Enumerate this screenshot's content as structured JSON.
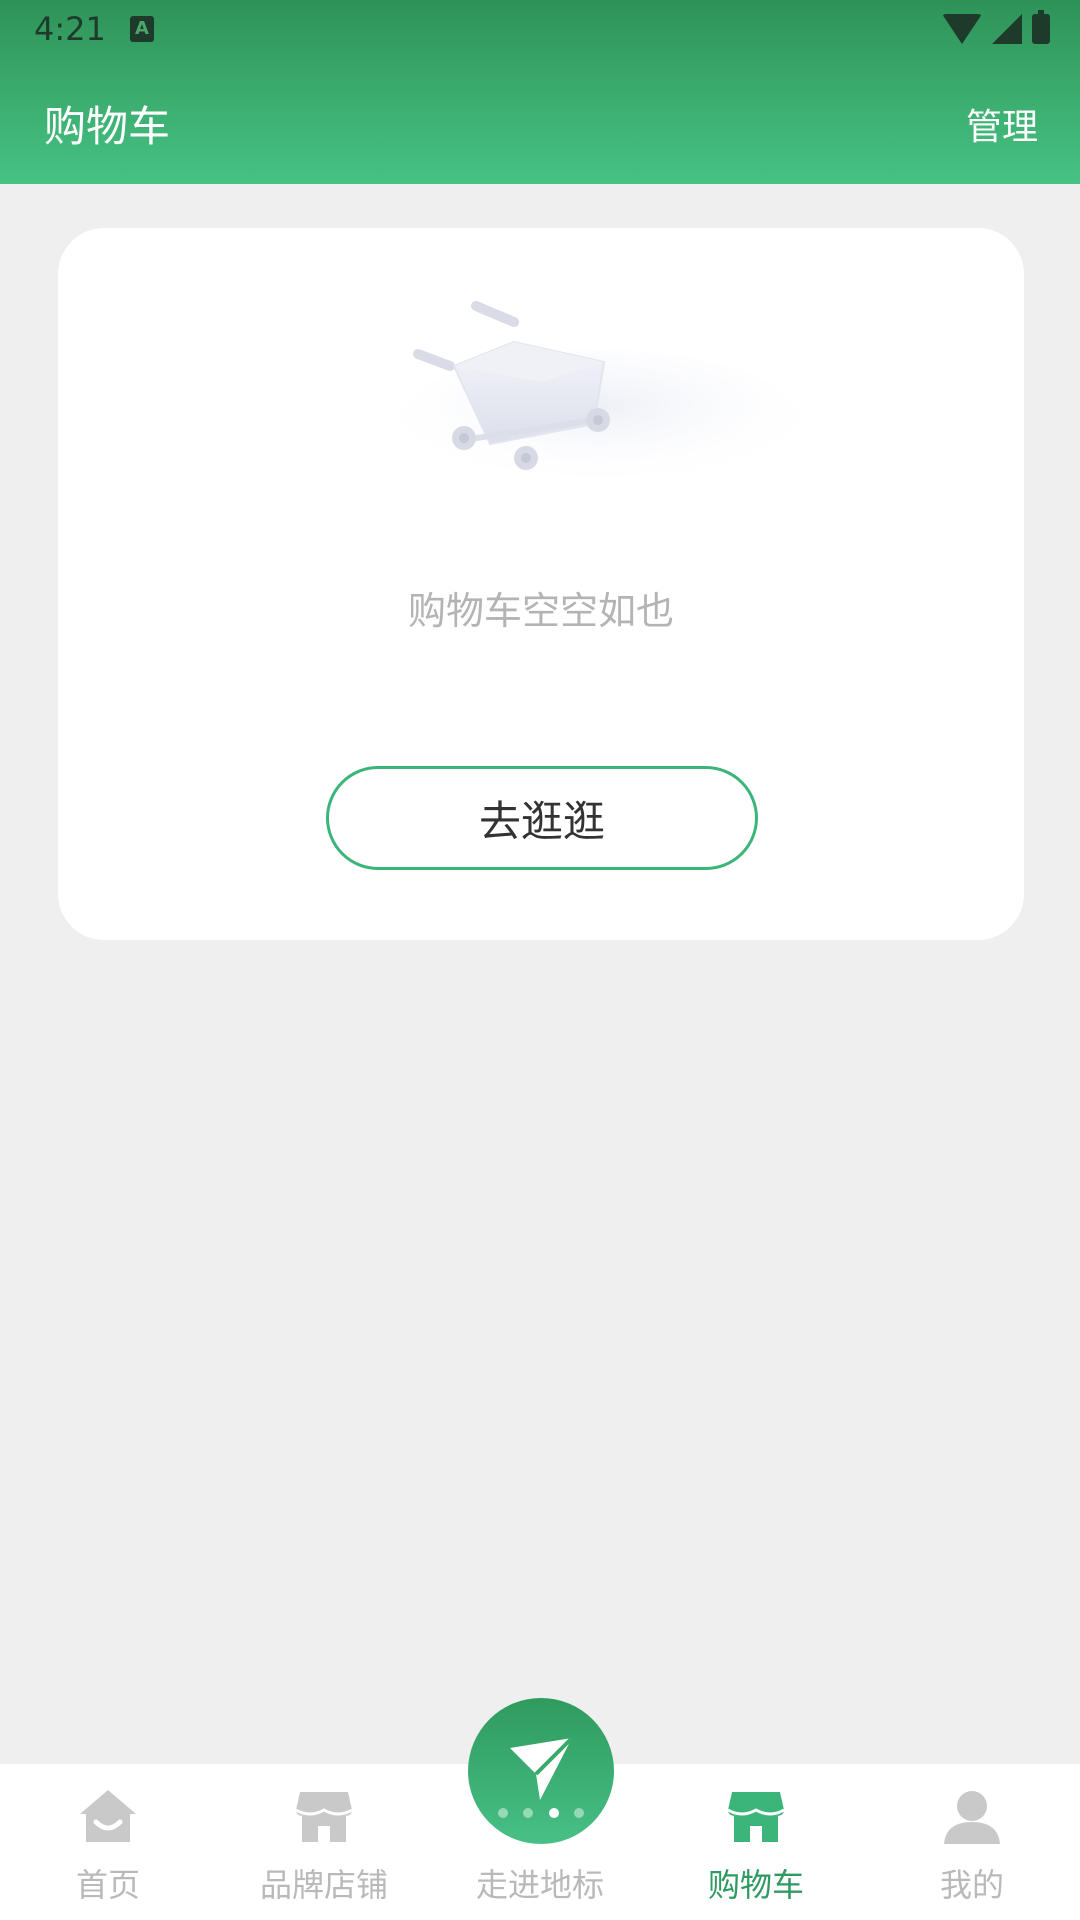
{
  "status_bar": {
    "time": "4:21",
    "indicator": "A"
  },
  "header": {
    "title": "购物车",
    "manage_label": "管理"
  },
  "empty_state": {
    "message": "购物车空空如也",
    "button_label": "去逛逛",
    "illustration": "shopping-cart-icon"
  },
  "tabbar": {
    "items": [
      {
        "label": "首页",
        "icon": "home-icon",
        "active": false
      },
      {
        "label": "品牌店铺",
        "icon": "store-icon",
        "active": false
      },
      {
        "label": "走进地标",
        "icon": "landmark-navigate-icon",
        "active": false
      },
      {
        "label": "购物车",
        "icon": "cart-store-icon",
        "active": true
      },
      {
        "label": "我的",
        "icon": "user-icon",
        "active": false
      }
    ],
    "carousel_dots": 4,
    "carousel_active": 3
  },
  "colors": {
    "brand_green": "#3bb57a",
    "header_dark": "#2e9258",
    "active_tab": "#2f9a62",
    "inactive_tab": "#b9b9b9",
    "background": "#efefef"
  }
}
